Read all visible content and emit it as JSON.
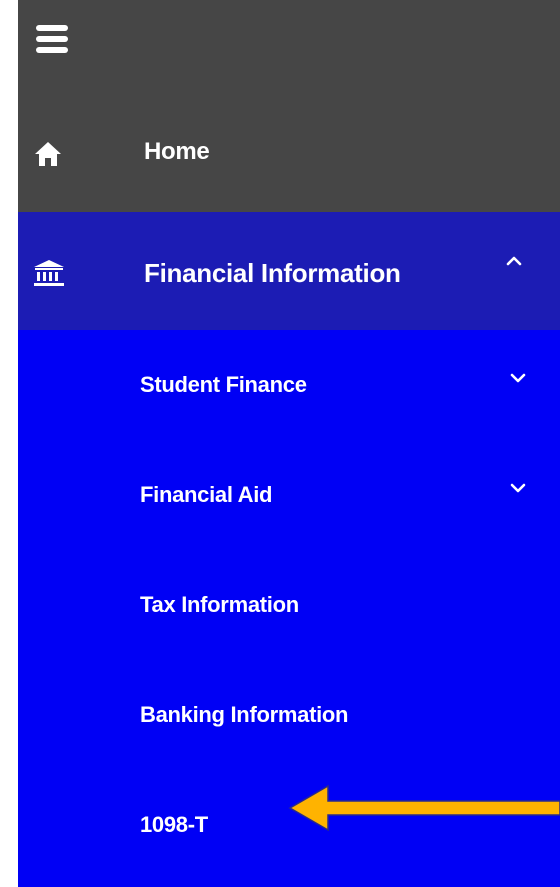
{
  "nav": {
    "menu_icon": "hamburger-icon",
    "home": {
      "label": "Home",
      "icon": "home-icon"
    },
    "financial_information": {
      "label": "Financial Information",
      "icon": "bank-icon",
      "expanded": true,
      "toggle_icon": "chevron-up-icon"
    },
    "submenu": [
      {
        "label": "Student Finance",
        "expandable": true,
        "toggle_icon": "chevron-down-icon"
      },
      {
        "label": "Financial Aid",
        "expandable": true,
        "toggle_icon": "chevron-down-icon"
      },
      {
        "label": "Tax Information",
        "expandable": false
      },
      {
        "label": "Banking Information",
        "expandable": false
      },
      {
        "label": "1098-T",
        "expandable": false,
        "highlighted": true
      }
    ]
  },
  "colors": {
    "header_bg": "#464646",
    "active_section_bg": "#1c1cb4",
    "submenu_bg": "#0000f5",
    "text": "#ffffff",
    "arrow": "#ffb300"
  }
}
